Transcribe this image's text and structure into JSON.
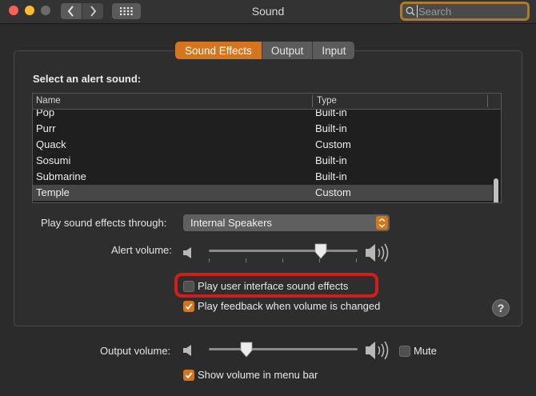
{
  "window": {
    "title": "Sound",
    "search_placeholder": "Search"
  },
  "tabs": [
    {
      "label": "Sound Effects",
      "active": true
    },
    {
      "label": "Output",
      "active": false
    },
    {
      "label": "Input",
      "active": false
    }
  ],
  "alert_section": {
    "label": "Select an alert sound:",
    "columns": [
      "Name",
      "Type"
    ],
    "rows": [
      {
        "name": "Pop",
        "type": "Built-in"
      },
      {
        "name": "Purr",
        "type": "Built-in"
      },
      {
        "name": "Quack",
        "type": "Custom"
      },
      {
        "name": "Sosumi",
        "type": "Built-in"
      },
      {
        "name": "Submarine",
        "type": "Built-in"
      },
      {
        "name": "Temple",
        "type": "Custom",
        "selected": true
      }
    ]
  },
  "play_through": {
    "label": "Play sound effects through:",
    "value": "Internal Speakers"
  },
  "alert_volume": {
    "label": "Alert volume:",
    "level": 0.75
  },
  "checkboxes": {
    "ui_sounds": {
      "label": "Play user interface sound effects",
      "checked": false
    },
    "feedback": {
      "label": "Play feedback when volume is changed",
      "checked": true
    }
  },
  "output_volume": {
    "label": "Output volume:",
    "level": 0.25,
    "mute_label": "Mute",
    "mute_checked": false
  },
  "menu_bar": {
    "label": "Show volume in menu bar",
    "checked": true
  },
  "help_label": "?",
  "colors": {
    "accent": "#d5761f",
    "highlight_ring": "#d21d1d",
    "search_focus": "#b07a2b"
  }
}
